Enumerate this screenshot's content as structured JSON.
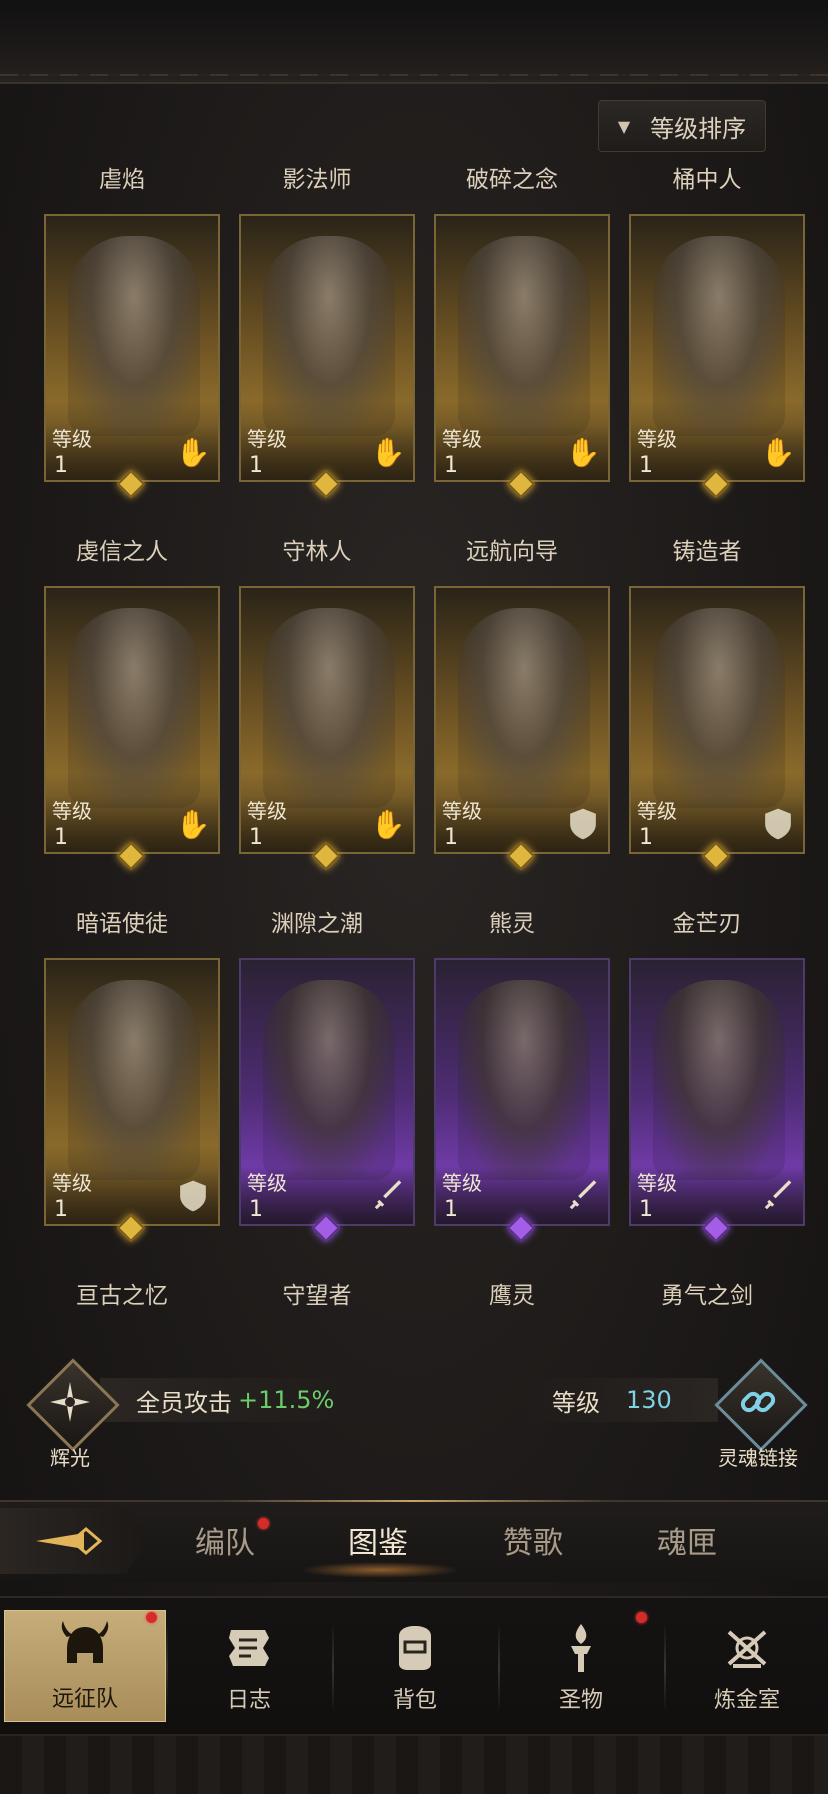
{
  "sort_button": {
    "label": "等级排序",
    "arrow": "▼"
  },
  "heroes": [
    {
      "name": "虐焰",
      "level_label": "等级",
      "level": "1",
      "rarity": "gold",
      "class_icon": "hand-icon"
    },
    {
      "name": "影法师",
      "level_label": "等级",
      "level": "1",
      "rarity": "gold",
      "class_icon": "hand-icon"
    },
    {
      "name": "破碎之念",
      "level_label": "等级",
      "level": "1",
      "rarity": "gold",
      "class_icon": "hand-icon"
    },
    {
      "name": "桶中人",
      "level_label": "等级",
      "level": "1",
      "rarity": "gold",
      "class_icon": "hand-icon"
    },
    {
      "name": "虔信之人",
      "level_label": "等级",
      "level": "1",
      "rarity": "gold",
      "class_icon": "hand-icon"
    },
    {
      "name": "守林人",
      "level_label": "等级",
      "level": "1",
      "rarity": "gold",
      "class_icon": "hand-icon"
    },
    {
      "name": "远航向导",
      "level_label": "等级",
      "level": "1",
      "rarity": "gold",
      "class_icon": "shield-icon"
    },
    {
      "name": "铸造者",
      "level_label": "等级",
      "level": "1",
      "rarity": "gold",
      "class_icon": "shield-icon"
    },
    {
      "name": "暗语使徒",
      "level_label": "等级",
      "level": "1",
      "rarity": "gold",
      "class_icon": "shield-icon"
    },
    {
      "name": "渊隙之潮",
      "level_label": "等级",
      "level": "1",
      "rarity": "purple",
      "class_icon": "sword-icon"
    },
    {
      "name": "熊灵",
      "level_label": "等级",
      "level": "1",
      "rarity": "purple",
      "class_icon": "sword-icon"
    },
    {
      "name": "金芒刃",
      "level_label": "等级",
      "level": "1",
      "rarity": "purple",
      "class_icon": "sword-icon"
    },
    {
      "name": "亘古之忆",
      "level_label": "",
      "level": "",
      "rarity": "",
      "class_icon": ""
    },
    {
      "name": "守望者",
      "level_label": "",
      "level": "",
      "rarity": "",
      "class_icon": ""
    },
    {
      "name": "鹰灵",
      "level_label": "",
      "level": "",
      "rarity": "",
      "class_icon": ""
    },
    {
      "name": "勇气之剑",
      "level_label": "",
      "level": "",
      "rarity": "",
      "class_icon": ""
    }
  ],
  "status": {
    "left_emblem_label": "辉光",
    "bonus_text": "全员攻击",
    "bonus_value": "+11.5%",
    "level_text": "等级",
    "level_value": "130",
    "right_emblem_label": "灵魂链接"
  },
  "subtabs": [
    {
      "label": "编队",
      "active": false,
      "badge": true
    },
    {
      "label": "图鉴",
      "active": true,
      "badge": false
    },
    {
      "label": "赞歌",
      "active": false,
      "badge": false
    },
    {
      "label": "魂匣",
      "active": false,
      "badge": false
    }
  ],
  "nav": [
    {
      "label": "远征队",
      "active": true,
      "badge": true,
      "icon": "helmet-icon"
    },
    {
      "label": "日志",
      "active": false,
      "badge": false,
      "icon": "scroll-icon"
    },
    {
      "label": "背包",
      "active": false,
      "badge": false,
      "icon": "bag-icon"
    },
    {
      "label": "圣物",
      "active": false,
      "badge": true,
      "icon": "torch-icon"
    },
    {
      "label": "炼金室",
      "active": false,
      "badge": false,
      "icon": "alchemy-icon"
    }
  ],
  "colors": {
    "gold_frame": "#8a6a2b",
    "purple_frame": "#6f3aa6",
    "bonus_green": "#6ccb6b",
    "level_cyan": "#7fd1e6",
    "badge_red": "#d62b2b"
  }
}
